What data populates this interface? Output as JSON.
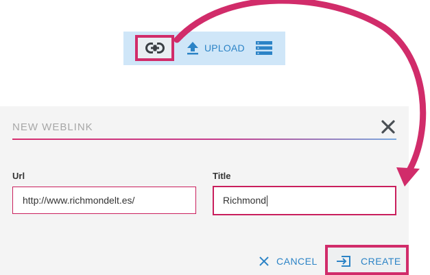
{
  "toolbar": {
    "link_icon": "link-icon",
    "upload_icon": "upload-icon",
    "upload_label": "UPLOAD",
    "list_icon": "list-view-icon"
  },
  "dialog": {
    "title": "NEW WEBLINK",
    "close_icon": "close-icon",
    "url_label": "Url",
    "url_value": "http://www.richmondelt.es/",
    "title_label": "Title",
    "title_value": "Richmond",
    "cancel_label": "CANCEL",
    "cancel_icon": "close-icon",
    "create_label": "CREATE",
    "create_icon": "create-icon"
  },
  "colors": {
    "highlight": "#d12c6a",
    "accent": "#2b83c6",
    "toolbar_bg": "#cfe6f8",
    "dialog_bg": "#f4f4f4",
    "input_border": "#c91e5c"
  }
}
